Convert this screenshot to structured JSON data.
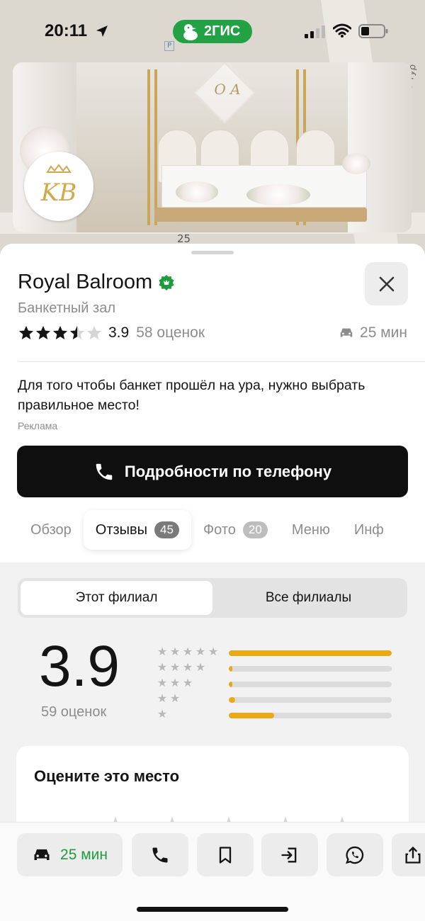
{
  "status_bar": {
    "time": "20:11",
    "brand": "2ГИС"
  },
  "map": {
    "house_number": "25",
    "street_label": "проспект Тур",
    "parking_sign": "P"
  },
  "banner": {
    "monogram": "O A",
    "logo_text": "KB"
  },
  "place": {
    "name": "Royal Balroom",
    "category": "Банкетный зал",
    "rating": "3.9",
    "rating_stars": 3.5,
    "ratings_count": "58 оценок",
    "drive_time": "25 мин",
    "ad_text": "Для того чтобы банкет прошёл на ура, нужно выбрать правильное место!",
    "ad_label": "Реклама",
    "phone_button": "Подробности по телефону"
  },
  "tabs": [
    {
      "label": "Обзор",
      "badge": ""
    },
    {
      "label": "Отзывы",
      "badge": "45",
      "active": true
    },
    {
      "label": "Фото",
      "badge": "20"
    },
    {
      "label": "Меню",
      "badge": ""
    },
    {
      "label": "Инф",
      "badge": ""
    }
  ],
  "reviews": {
    "segments": [
      "Этот филиал",
      "Все филиалы"
    ],
    "active_segment": 0,
    "rating": "3.9",
    "count": "59 оценок",
    "distribution": [
      {
        "stars": 5,
        "fraction": 1.0
      },
      {
        "stars": 4,
        "fraction": 0.02
      },
      {
        "stars": 3,
        "fraction": 0.02
      },
      {
        "stars": 2,
        "fraction": 0.04
      },
      {
        "stars": 1,
        "fraction": 0.28
      }
    ],
    "rate_title": "Оцените это место"
  },
  "bottom_bar": {
    "drive_time": "25 мин"
  },
  "colors": {
    "brand_green": "#23a245",
    "accent_orange": "#eaa917",
    "drive_green": "#1e9b3c"
  },
  "icons": [
    "location-arrow-icon",
    "duck-icon",
    "signal-icon",
    "wifi-icon",
    "battery-icon",
    "verified-icon",
    "close-icon",
    "car-icon",
    "phone-icon",
    "bookmark-icon",
    "enter-icon",
    "whatsapp-icon",
    "share-icon"
  ]
}
